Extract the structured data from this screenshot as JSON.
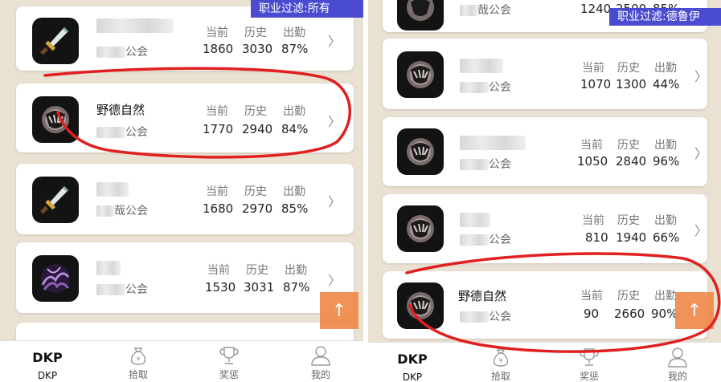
{
  "left_panel": {
    "filter_label": "职业过滤:所有",
    "cards": [
      {
        "name": "",
        "guild": "公会",
        "guild_prefix": "",
        "icon": "sword-icon",
        "current": "1860",
        "history": "3030",
        "attendance": "87%"
      },
      {
        "name": "野德自然",
        "guild": "公会",
        "guild_prefix": "",
        "icon": "bear-claw-icon",
        "current": "1770",
        "history": "2940",
        "attendance": "84%"
      },
      {
        "name": "",
        "guild": "公会",
        "guild_prefix": "哉",
        "icon": "sword-icon",
        "current": "1680",
        "history": "2970",
        "attendance": "85%"
      },
      {
        "name": "",
        "guild": "公会",
        "guild_prefix": "",
        "icon": "shadow-tentacle-icon",
        "current": "1530",
        "history": "3031",
        "attendance": "87%"
      }
    ]
  },
  "right_panel": {
    "filter_label": "职业过滤:德鲁伊",
    "top_partial": {
      "guild": "公会",
      "guild_prefix": "哉",
      "current": "1240",
      "history": "2500",
      "attendance": "85%"
    },
    "cards": [
      {
        "name": "",
        "guild": "公会",
        "guild_prefix": "",
        "icon": "bear-claw-icon",
        "current": "1070",
        "history": "1300",
        "attendance": "44%"
      },
      {
        "name": "",
        "guild": "公会",
        "guild_prefix": "",
        "icon": "bear-claw-icon",
        "current": "1050",
        "history": "2840",
        "attendance": "96%"
      },
      {
        "name": "",
        "guild": "公会",
        "guild_prefix": "",
        "icon": "bear-claw-icon",
        "current": "810",
        "history": "1940",
        "attendance": "66%"
      },
      {
        "name": "野德自然",
        "guild": "公会",
        "guild_prefix": "",
        "icon": "bear-claw-icon",
        "current": "90",
        "history": "2660",
        "attendance": "90%"
      }
    ]
  },
  "stat_headers": {
    "current": "当前",
    "history": "历史",
    "attendance": "出勤"
  },
  "chevron": "〉",
  "scroll_top_glyph": "↑",
  "tabs": [
    {
      "label": "DKP",
      "icon_text": "DKP",
      "icon": "dkp-text-icon",
      "active": true
    },
    {
      "label": "拾取",
      "icon": "money-bag-icon",
      "active": false
    },
    {
      "label": "奖惩",
      "icon": "trophy-icon",
      "active": false
    },
    {
      "label": "我的",
      "icon": "user-icon",
      "active": false
    }
  ],
  "colors": {
    "filter_badge": "#4b4bd1",
    "scroll_top": "#f08a4b",
    "annotation": "#e02020",
    "background": "#e9e1d2"
  }
}
